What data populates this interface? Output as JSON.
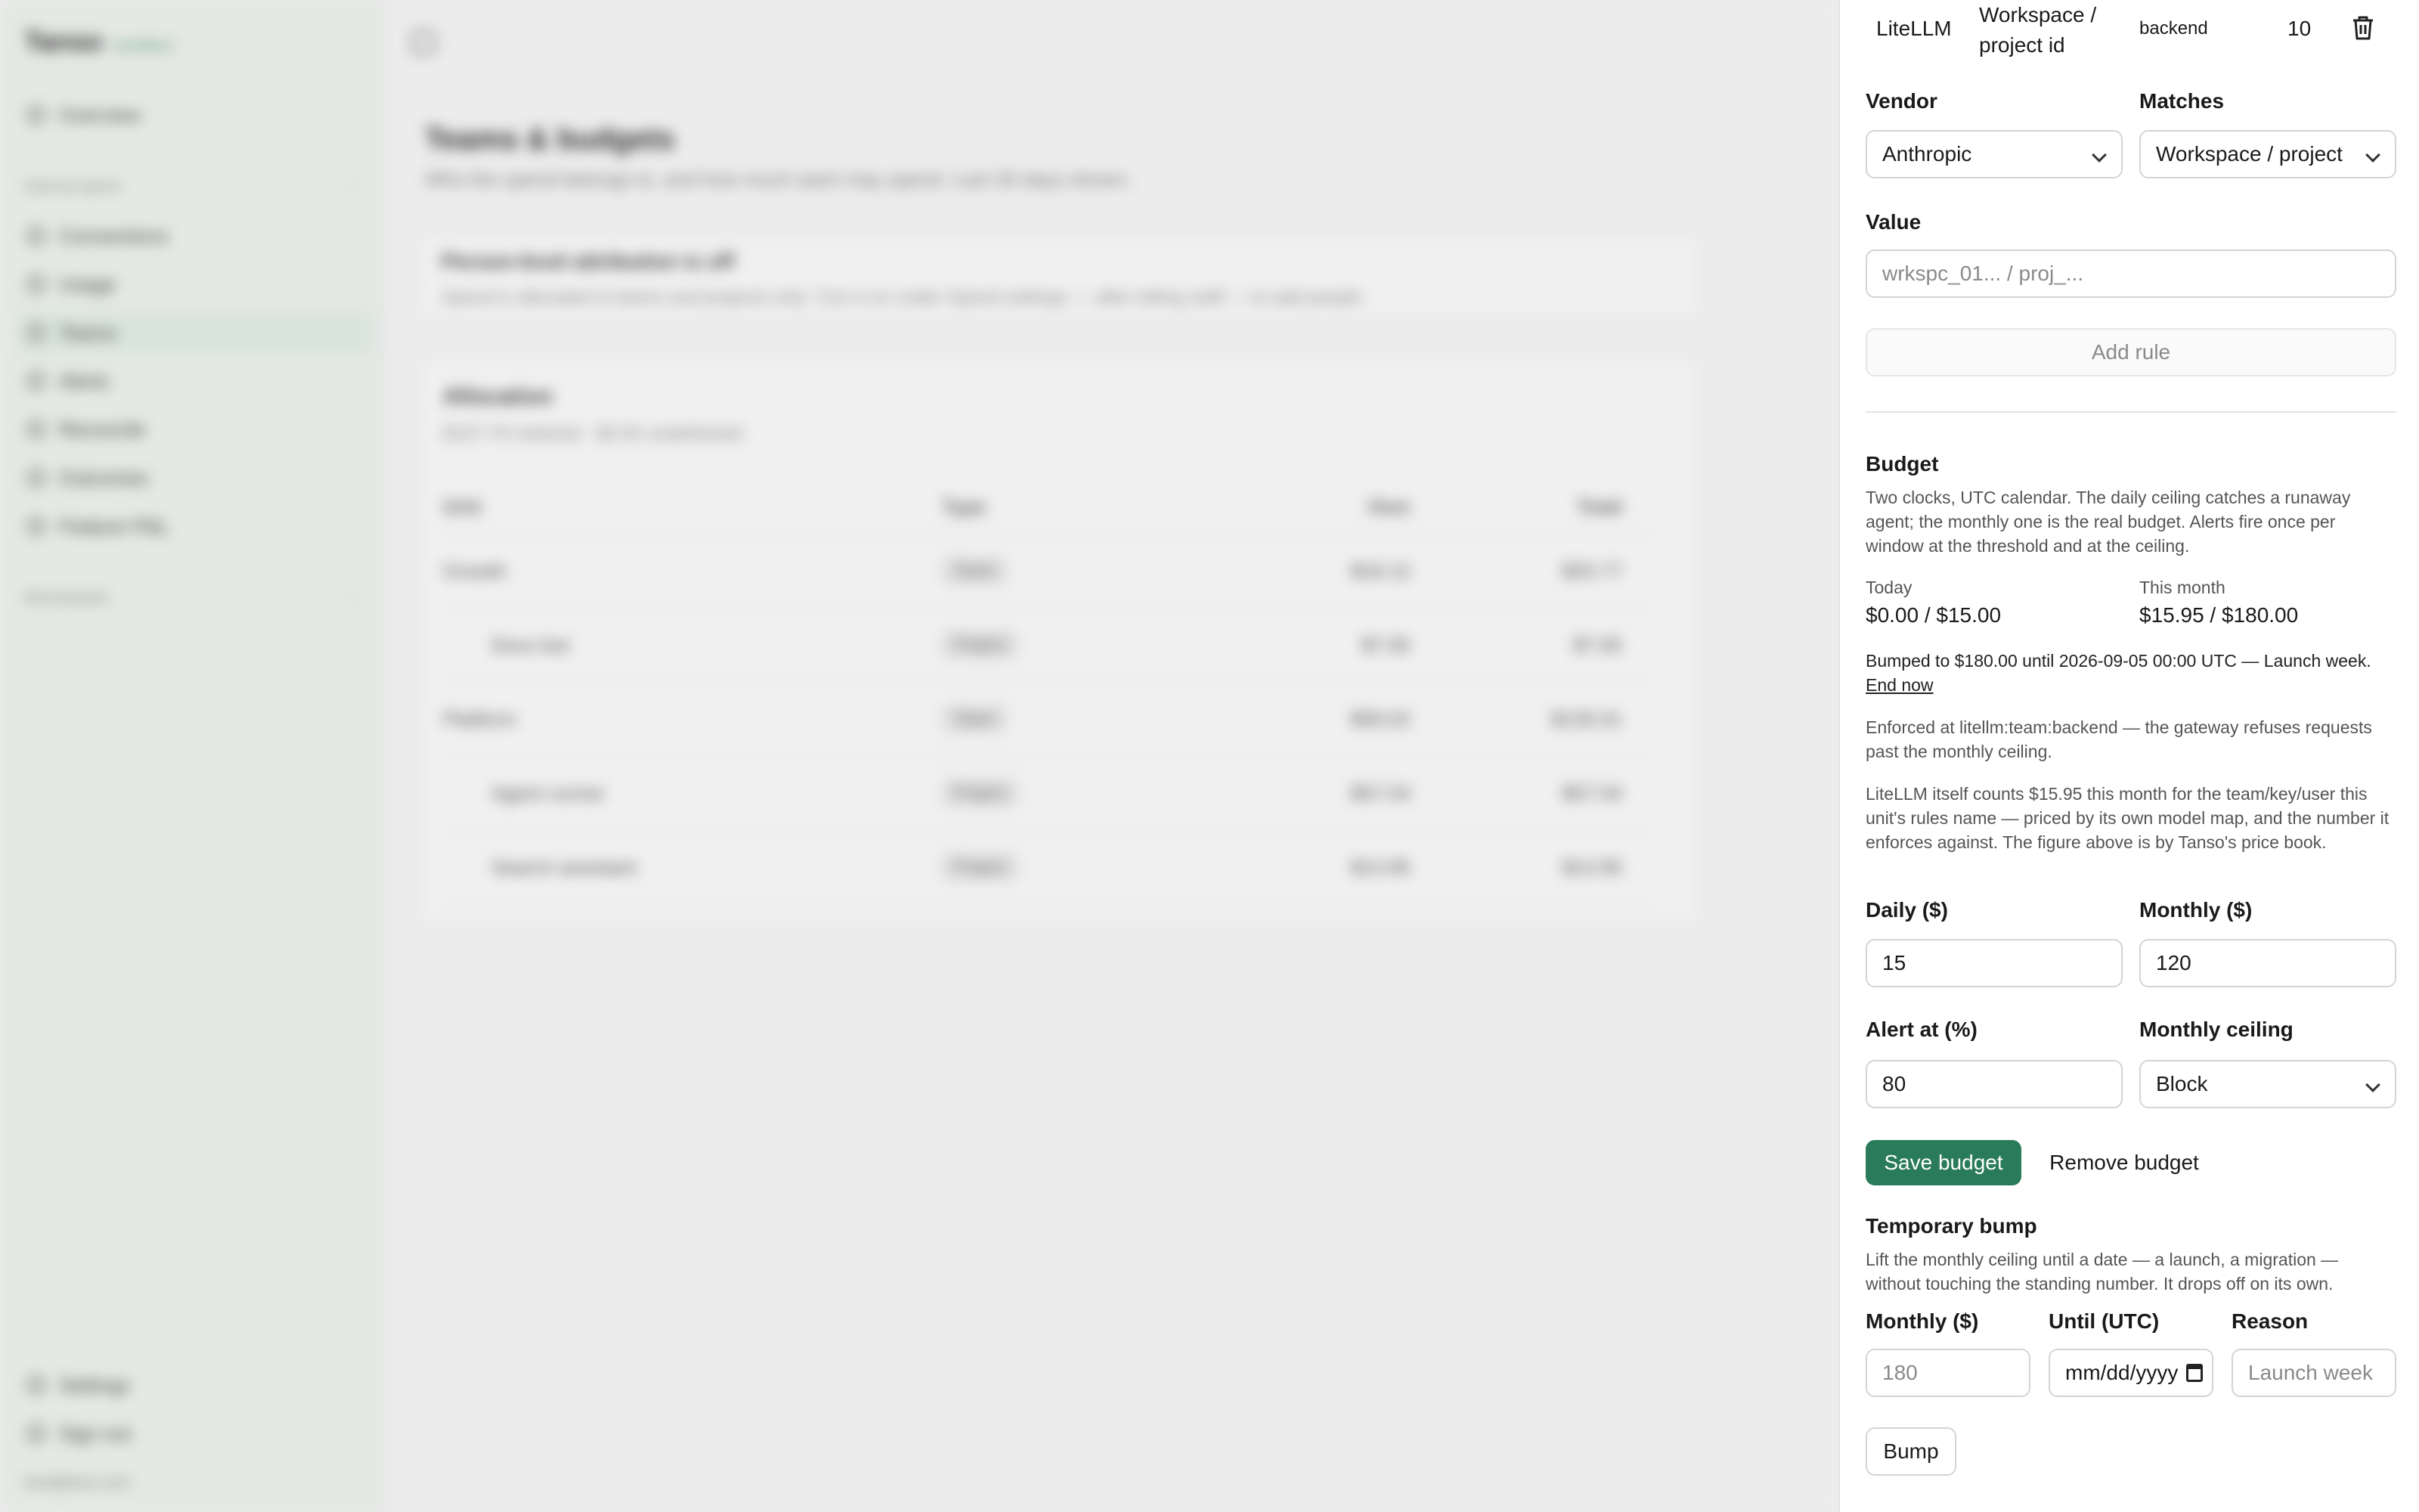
{
  "app": {
    "name": "Tanso",
    "tag": "sandbox"
  },
  "sidebar": {
    "overview": "Overview",
    "section_internal": "Internal spend",
    "items": [
      "Connections",
      "Usage",
      "Teams",
      "Alerts",
      "Reconcile",
      "Outcomes",
      "Feature P&L"
    ],
    "section_monetization": "Monetization",
    "footer_items": [
      "Settings",
      "Sign out"
    ],
    "user_email": "test@test.com"
  },
  "main": {
    "title": "Teams & budgets",
    "subtitle": "Who the spend belongs to, and how much each may spend. Last 30 days shown.",
    "notice_title": "Person-level attribution is off",
    "notice_text": "Spend is allocated to teams and projects only. Turn it on under Spend settings — after telling staff — to add people.",
    "allocation": {
      "title": "Allocation",
      "subtitle": "$107.79 metered · $0.00 unattributed",
      "columns": [
        "Unit",
        "Type",
        "Own",
        "Total"
      ],
      "rows": [
        {
          "unit": "Growth",
          "type": "Team",
          "own": "$18.12",
          "total": "$25.77",
          "child": false
        },
        {
          "unit": "Docs bot",
          "type": "Project",
          "own": "$7.65",
          "total": "$7.65",
          "child": true
        },
        {
          "unit": "Platform",
          "type": "Team",
          "own": "$59.02",
          "total": "$130.01",
          "child": false
        },
        {
          "unit": "Agent runner",
          "type": "Project",
          "own": "$57.04",
          "total": "$57.04",
          "child": true
        },
        {
          "unit": "Search assistant",
          "type": "Project",
          "own": "$13.95",
          "total": "$13.95",
          "child": true
        }
      ]
    }
  },
  "panel": {
    "rule_row": {
      "vendor": "LiteLLM",
      "matches": "Workspace / project id",
      "value": "backend",
      "count": "10"
    },
    "vendor_label": "Vendor",
    "vendor_value": "Anthropic",
    "matches_label": "Matches",
    "matches_value": "Workspace / project",
    "value_label": "Value",
    "value_placeholder": "wrkspc_01... / proj_...",
    "add_rule": "Add rule",
    "budget": {
      "heading": "Budget",
      "description": "Two clocks, UTC calendar. The daily ceiling catches a runaway agent; the monthly one is the real budget. Alerts fire once per window at the threshold and at the ceiling.",
      "today_label": "Today",
      "today_value": "$0.00 / $15.00",
      "month_label": "This month",
      "month_value": "$15.95 / $180.00",
      "bump_note": "Bumped to $180.00 until 2026-09-05 00:00 UTC — Launch week.",
      "end_now": "End now",
      "enforced": "Enforced at litellm:team:backend — the gateway refuses requests past the monthly ceiling.",
      "litellm_note": "LiteLLM itself counts $15.95 this month for the team/key/user this unit's rules name — priced by its own model map, and the number it enforces against. The figure above is by Tanso's price book.",
      "daily_label": "Daily ($)",
      "daily_value": "15",
      "monthly_label": "Monthly ($)",
      "monthly_value": "120",
      "alert_label": "Alert at (%)",
      "alert_value": "80",
      "ceiling_label": "Monthly ceiling",
      "ceiling_value": "Block",
      "save": "Save budget",
      "remove": "Remove budget"
    },
    "bump": {
      "heading": "Temporary bump",
      "description": "Lift the monthly ceiling until a date — a launch, a migration — without touching the standing number. It drops off on its own.",
      "monthly_label": "Monthly ($)",
      "monthly_placeholder": "180",
      "until_label": "Until (UTC)",
      "until_placeholder": "mm/dd/yyyy",
      "reason_label": "Reason",
      "reason_placeholder": "Launch week",
      "button": "Bump"
    }
  }
}
